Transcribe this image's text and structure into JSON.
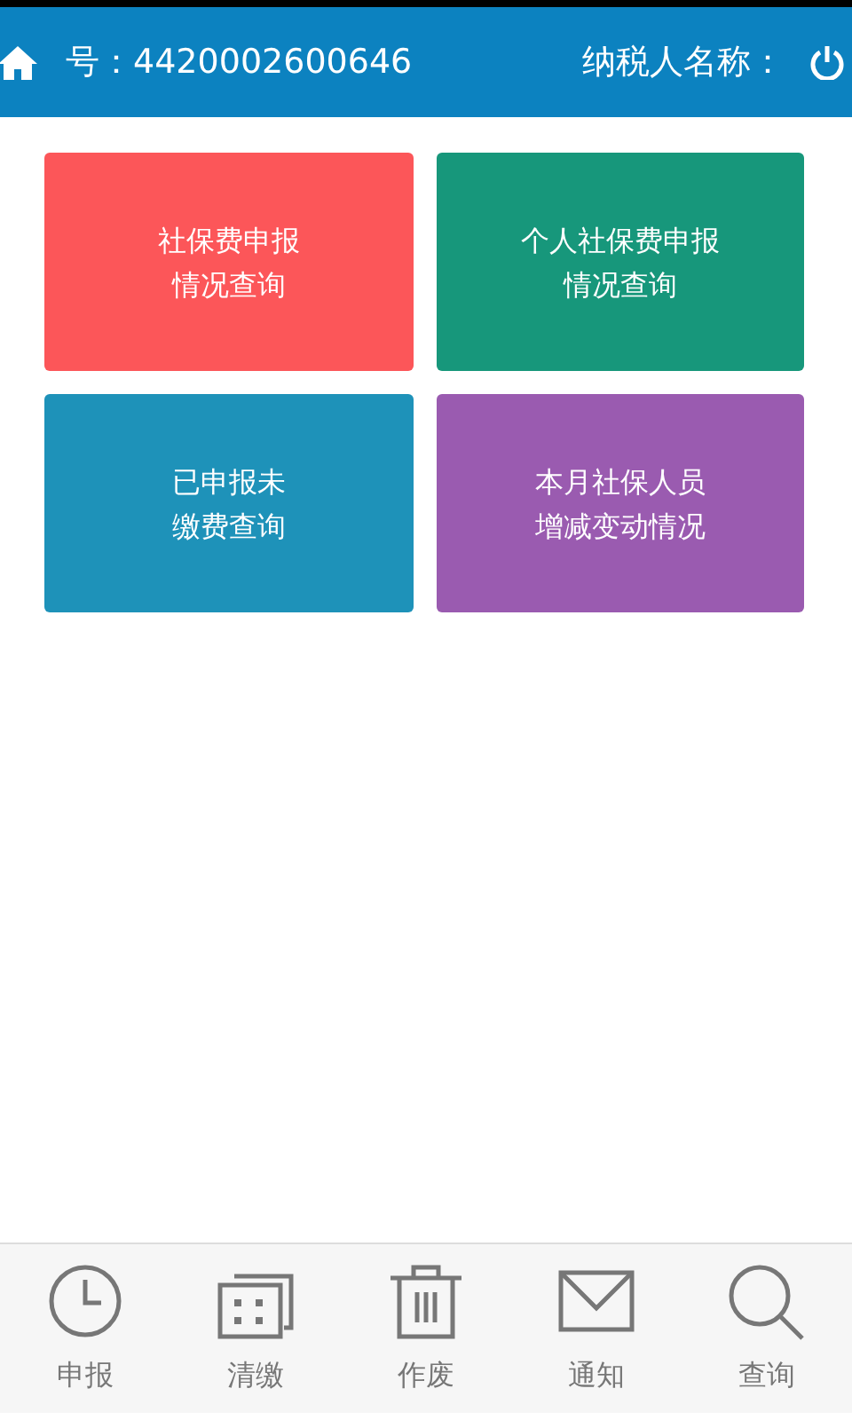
{
  "header": {
    "account": "号：4420002600646",
    "taxpayer": "纳税人名称："
  },
  "tiles": [
    {
      "lines": [
        "社保费申报",
        "情况查询"
      ],
      "color": "#fc5659"
    },
    {
      "lines": [
        "个人社保费申报",
        "情况查询"
      ],
      "color": "#17977b"
    },
    {
      "lines": [
        "已申报未",
        "缴费查询"
      ],
      "color": "#1e92b9"
    },
    {
      "lines": [
        "本月社保人员",
        "增减变动情况"
      ],
      "color": "#9a5bb0"
    }
  ],
  "nav": [
    {
      "label": "申报",
      "kind": "clock"
    },
    {
      "label": "清缴",
      "kind": "stack"
    },
    {
      "label": "作废",
      "kind": "trash"
    },
    {
      "label": "通知",
      "kind": "mail"
    },
    {
      "label": "查询",
      "kind": "search"
    }
  ]
}
